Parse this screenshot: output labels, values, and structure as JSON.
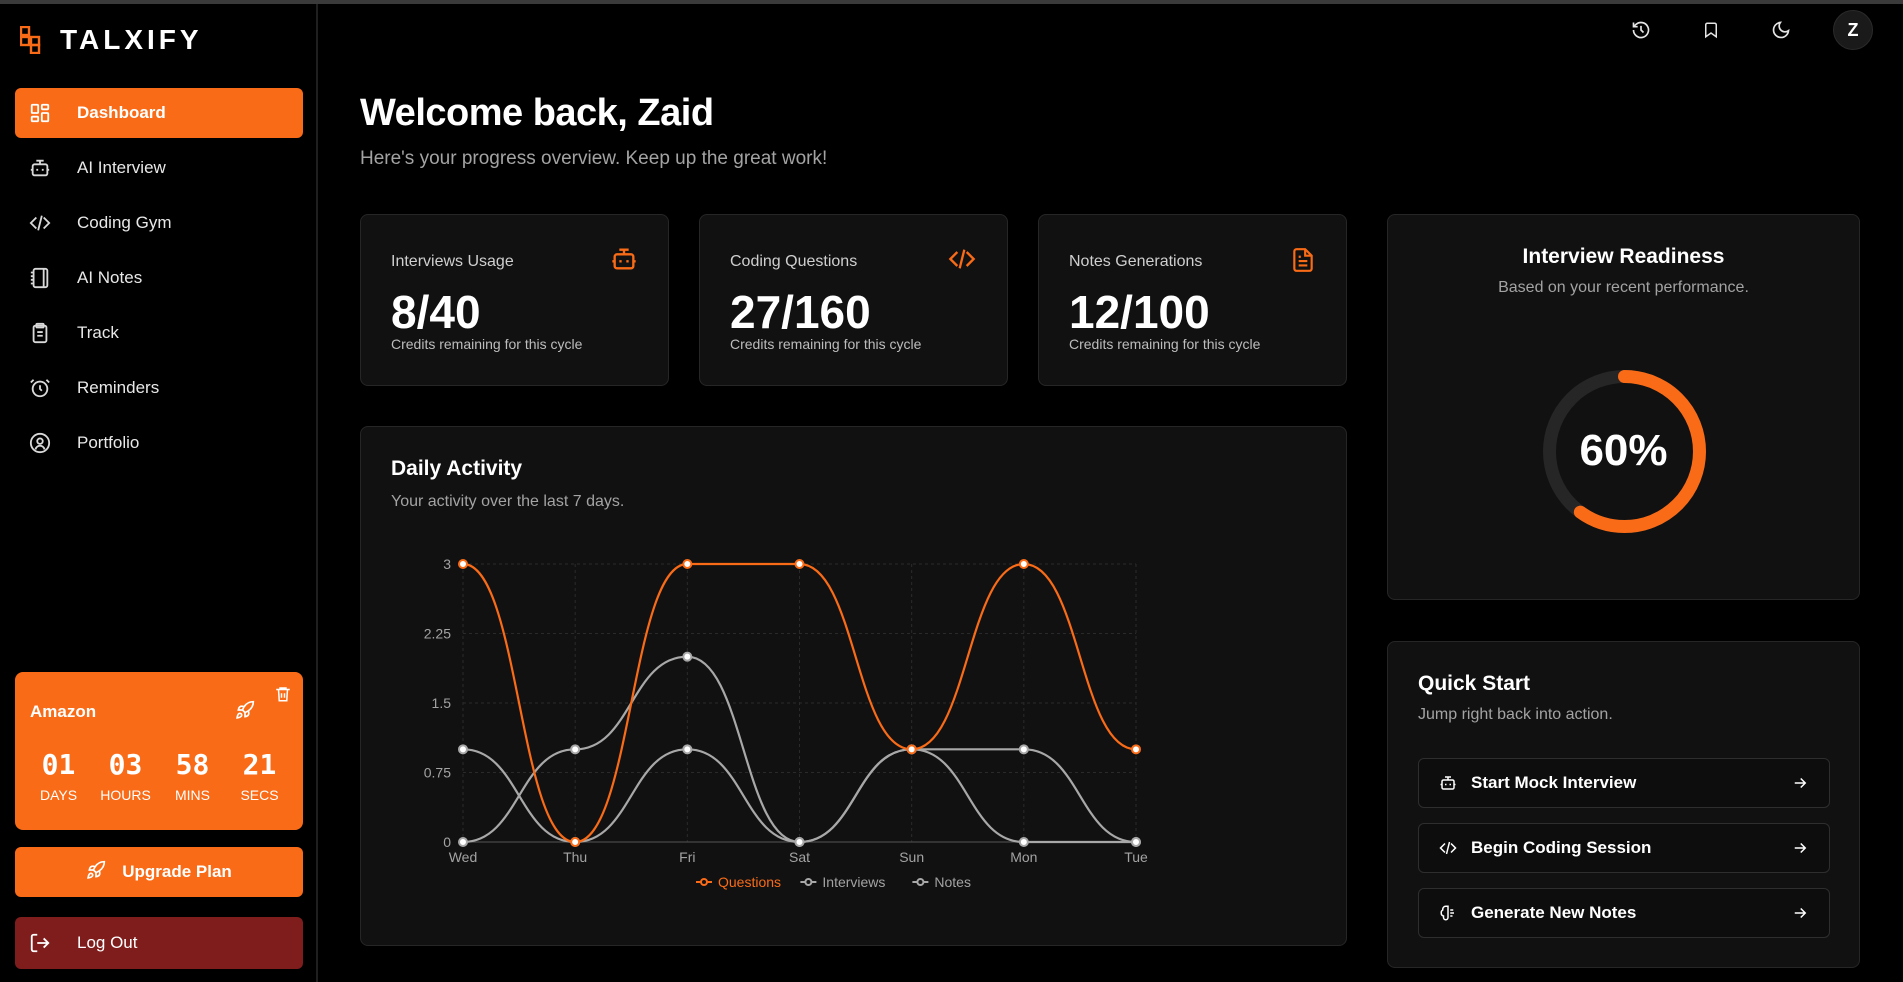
{
  "app": {
    "brand": "TALXIFY"
  },
  "sidebar": {
    "items": [
      {
        "label": "Dashboard",
        "icon": "dashboard-icon",
        "active": true
      },
      {
        "label": "AI Interview",
        "icon": "robot-icon"
      },
      {
        "label": "Coding Gym",
        "icon": "code-icon"
      },
      {
        "label": "AI Notes",
        "icon": "notebook-icon"
      },
      {
        "label": "Track",
        "icon": "clipboard-icon"
      },
      {
        "label": "Reminders",
        "icon": "alarm-clock-icon"
      },
      {
        "label": "Portfolio",
        "icon": "user-circle-icon"
      }
    ],
    "countdown": {
      "company": "Amazon",
      "days": "01",
      "hours": "03",
      "mins": "58",
      "secs": "21",
      "days_label": "DAYS",
      "hours_label": "HOURS",
      "mins_label": "MINS",
      "secs_label": "SECS"
    },
    "upgrade_label": "Upgrade Plan",
    "logout_label": "Log Out"
  },
  "header": {
    "avatar_initial": "Z"
  },
  "welcome": {
    "title": "Welcome back, Zaid",
    "subtitle": "Here's your progress overview. Keep up the great work!"
  },
  "stats": [
    {
      "label": "Interviews Usage",
      "value": "8/40",
      "note": "Credits remaining for this cycle",
      "icon": "robot-icon"
    },
    {
      "label": "Coding Questions",
      "value": "27/160",
      "note": "Credits remaining for this cycle",
      "icon": "code-icon"
    },
    {
      "label": "Notes Generations",
      "value": "12/100",
      "note": "Credits remaining for this cycle",
      "icon": "file-text-icon"
    }
  ],
  "activity": {
    "title": "Daily Activity",
    "subtitle": "Your activity over the last 7 days."
  },
  "chart_data": {
    "type": "line",
    "categories": [
      "Wed",
      "Thu",
      "Fri",
      "Sat",
      "Sun",
      "Mon",
      "Tue"
    ],
    "yticks": [
      "0",
      "0.75",
      "1.5",
      "2.25",
      "3"
    ],
    "ylim": [
      0,
      3
    ],
    "grid": true,
    "legend_position": "bottom",
    "series": [
      {
        "name": "Questions",
        "values": [
          3,
          0,
          3,
          3,
          1,
          3,
          1
        ],
        "color": "#f96b17"
      },
      {
        "name": "Interviews",
        "values": [
          1,
          0,
          1,
          0,
          1,
          1,
          0
        ],
        "color": "#a8a8a8"
      },
      {
        "name": "Notes",
        "values": [
          0,
          1,
          2,
          0,
          1,
          0,
          0
        ],
        "color": "#a8a8a8"
      }
    ]
  },
  "readiness": {
    "title": "Interview Readiness",
    "subtitle": "Based on your recent performance.",
    "percent_text": "60%",
    "percent": 0.6
  },
  "quick_start": {
    "title": "Quick Start",
    "subtitle": "Jump right back into action.",
    "buttons": [
      {
        "label": "Start Mock Interview",
        "icon": "robot-icon"
      },
      {
        "label": "Begin Coding Session",
        "icon": "code-icon"
      },
      {
        "label": "Generate New Notes",
        "icon": "brain-icon"
      }
    ]
  },
  "colors": {
    "accent": "#f96b17",
    "danger": "#7f1d1d",
    "card": "#111111"
  }
}
